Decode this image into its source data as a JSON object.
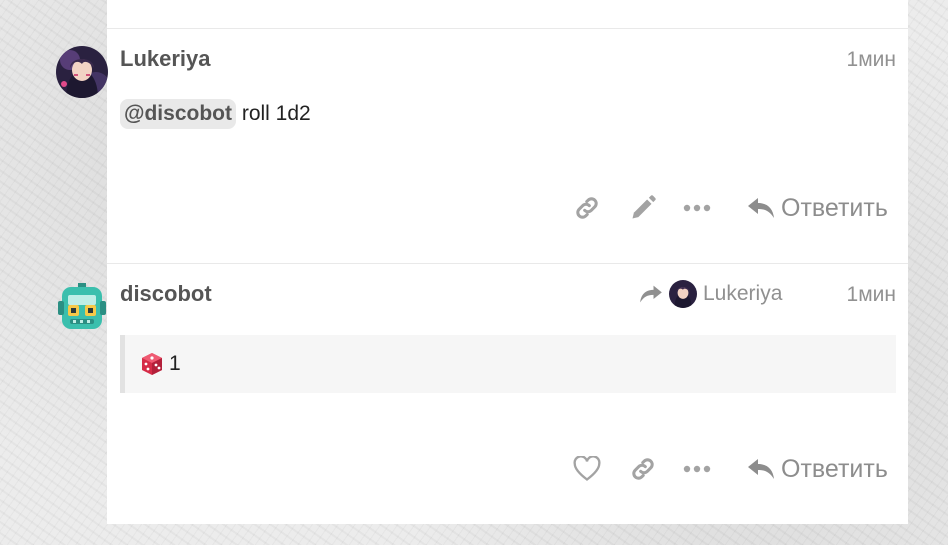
{
  "posts": [
    {
      "username": "Lukeriya",
      "time": "1мин",
      "mention": "@discobot",
      "text": "roll 1d2",
      "reply_label": "Ответить",
      "avatar": "anime-girl-avatar"
    },
    {
      "username": "discobot",
      "time": "1мин",
      "reply_to": "Lukeriya",
      "roll_result": "1",
      "reply_label": "Ответить",
      "avatar": "robot-avatar"
    }
  ],
  "icons": {
    "link": "link-icon",
    "edit": "pencil-icon",
    "more": "ellipsis-icon",
    "reply": "reply-arrow-icon",
    "like": "heart-icon",
    "dice": "dice-icon"
  },
  "colors": {
    "robot_teal": "#3bbfad",
    "dice_red": "#d62b47",
    "muted_icon": "#a3a3a3"
  }
}
